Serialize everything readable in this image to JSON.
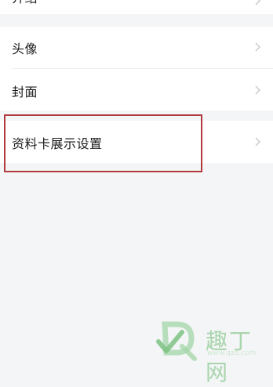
{
  "top_partial": {
    "label": "介绍"
  },
  "menu": {
    "items": [
      {
        "label": "头像"
      },
      {
        "label": "封面"
      },
      {
        "label": "资料卡展示设置"
      }
    ]
  },
  "watermark": {
    "brand": "趣丁网",
    "url": "www.qzd.com"
  }
}
